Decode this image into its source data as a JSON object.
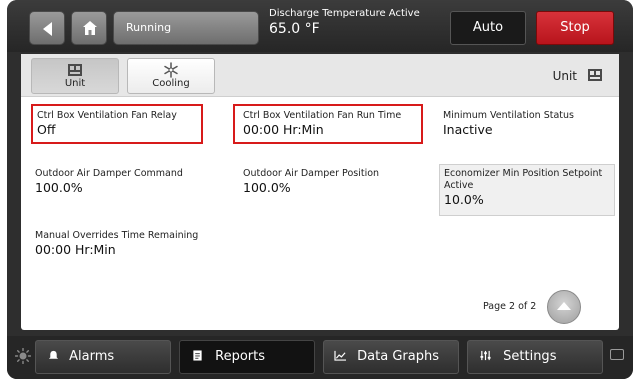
{
  "topbar": {
    "status_label": "Running",
    "discharge_label": "Discharge Temperature Active",
    "discharge_value": "65.0 °F",
    "auto_label": "Auto",
    "stop_label": "Stop",
    "icons": {
      "back": "back-arrow-icon",
      "home": "home-icon"
    }
  },
  "tabs": [
    {
      "label": "Unit",
      "icon": "unit-icon",
      "active": true
    },
    {
      "label": "Cooling",
      "icon": "snowflake-icon",
      "active": false
    }
  ],
  "header": {
    "unit_label": "Unit",
    "unit_icon": "unit-icon"
  },
  "params": [
    {
      "label": "Ctrl Box Ventilation Fan Relay",
      "value": "Off",
      "highlighted": true
    },
    {
      "label": "Ctrl Box Ventilation Fan Run Time",
      "value": "00:00 Hr:Min",
      "highlighted": true
    },
    {
      "label": "Minimum Ventilation Status",
      "value": "Inactive"
    },
    {
      "label": "Outdoor Air Damper Command",
      "value": "100.0%"
    },
    {
      "label": "Outdoor Air Damper Position",
      "value": "100.0%"
    },
    {
      "label": "Economizer Min Position Setpoint Active",
      "value": "10.0%"
    },
    {
      "label": "Manual Overrides Time Remaining",
      "value": "00:00 Hr:Min"
    }
  ],
  "pagination": {
    "label": "Page 2 of 2"
  },
  "bottom_nav": [
    {
      "label": "Alarms",
      "icon": "bell-icon"
    },
    {
      "label": "Reports",
      "icon": "document-icon",
      "active": true
    },
    {
      "label": "Data Graphs",
      "icon": "graph-icon"
    },
    {
      "label": "Settings",
      "icon": "sliders-icon"
    }
  ],
  "colors": {
    "highlight": "#d71a1a",
    "stop": "#c8202a",
    "frame": "#2e2e2e"
  }
}
